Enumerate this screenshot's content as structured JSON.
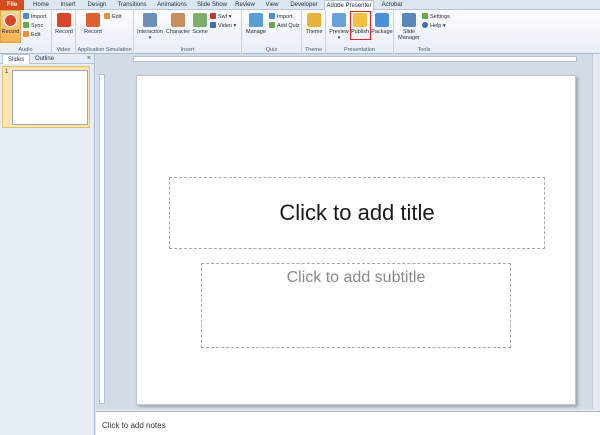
{
  "tabs": [
    "File",
    "Home",
    "Insert",
    "Design",
    "Transitions",
    "Animations",
    "Slide Show",
    "Review",
    "View",
    "Developer",
    "Adobe Presenter",
    "Acrobat"
  ],
  "ribbon": {
    "audio": {
      "label": "Audio",
      "record": "Record",
      "import": "Import",
      "sync": "Sync",
      "edit": "Edit"
    },
    "video": {
      "label": "Video",
      "record": "Record"
    },
    "appsim": {
      "label": "Application Simulation",
      "record": "Record",
      "edit": "Edit"
    },
    "insert": {
      "label": "Insert",
      "interaction": "Interaction",
      "character": "Character",
      "scene": "Scene",
      "swf": "Swf",
      "video": "Video"
    },
    "quiz": {
      "label": "Quiz",
      "manage": "Manage",
      "import": "Import",
      "add_quiz": "Add Quiz"
    },
    "theme": {
      "label": "Theme",
      "theme": "Theme"
    },
    "presentation": {
      "label": "Presentation",
      "preview": "Preview",
      "publish": "Publish",
      "package": "Package"
    },
    "tools": {
      "label": "Tools",
      "slide_manager_1": "Slide",
      "slide_manager_2": "Manager",
      "settings": "Settings",
      "help": "Help"
    }
  },
  "pane": {
    "slides_tab": "Slides",
    "outline_tab": "Outline",
    "slide_number": "1",
    "close": "×"
  },
  "slide": {
    "title_placeholder": "Click to add title",
    "subtitle_placeholder": "Click to add subtitle"
  },
  "notes": {
    "placeholder": "Click to add notes"
  }
}
